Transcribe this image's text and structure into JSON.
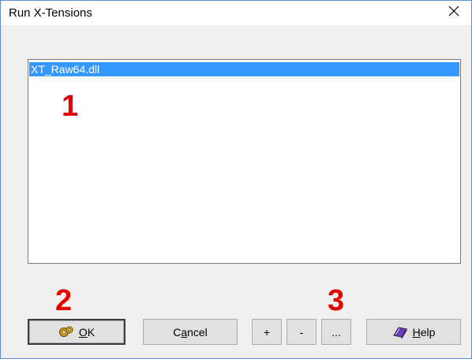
{
  "window": {
    "title": "Run X-Tensions",
    "close_glyph": "✕"
  },
  "listbox": {
    "items": [
      {
        "label": "XT_Raw64.dll",
        "selected": true
      }
    ]
  },
  "annotations": {
    "a1": "1",
    "a2": "2",
    "a3": "3",
    "color": "#e60000"
  },
  "buttons": {
    "ok": {
      "icon": "gear-icon",
      "accel": "O",
      "rest": "K"
    },
    "cancel": {
      "pre": "C",
      "accel": "a",
      "rest": "ncel"
    },
    "add": "+",
    "remove": "-",
    "browse": "...",
    "help": {
      "icon": "book-icon",
      "accel": "H",
      "rest": "elp"
    }
  },
  "colors": {
    "selection": "#3399ff",
    "dialog_bg": "#f0f0f0",
    "window_border": "#5a8ad6"
  }
}
